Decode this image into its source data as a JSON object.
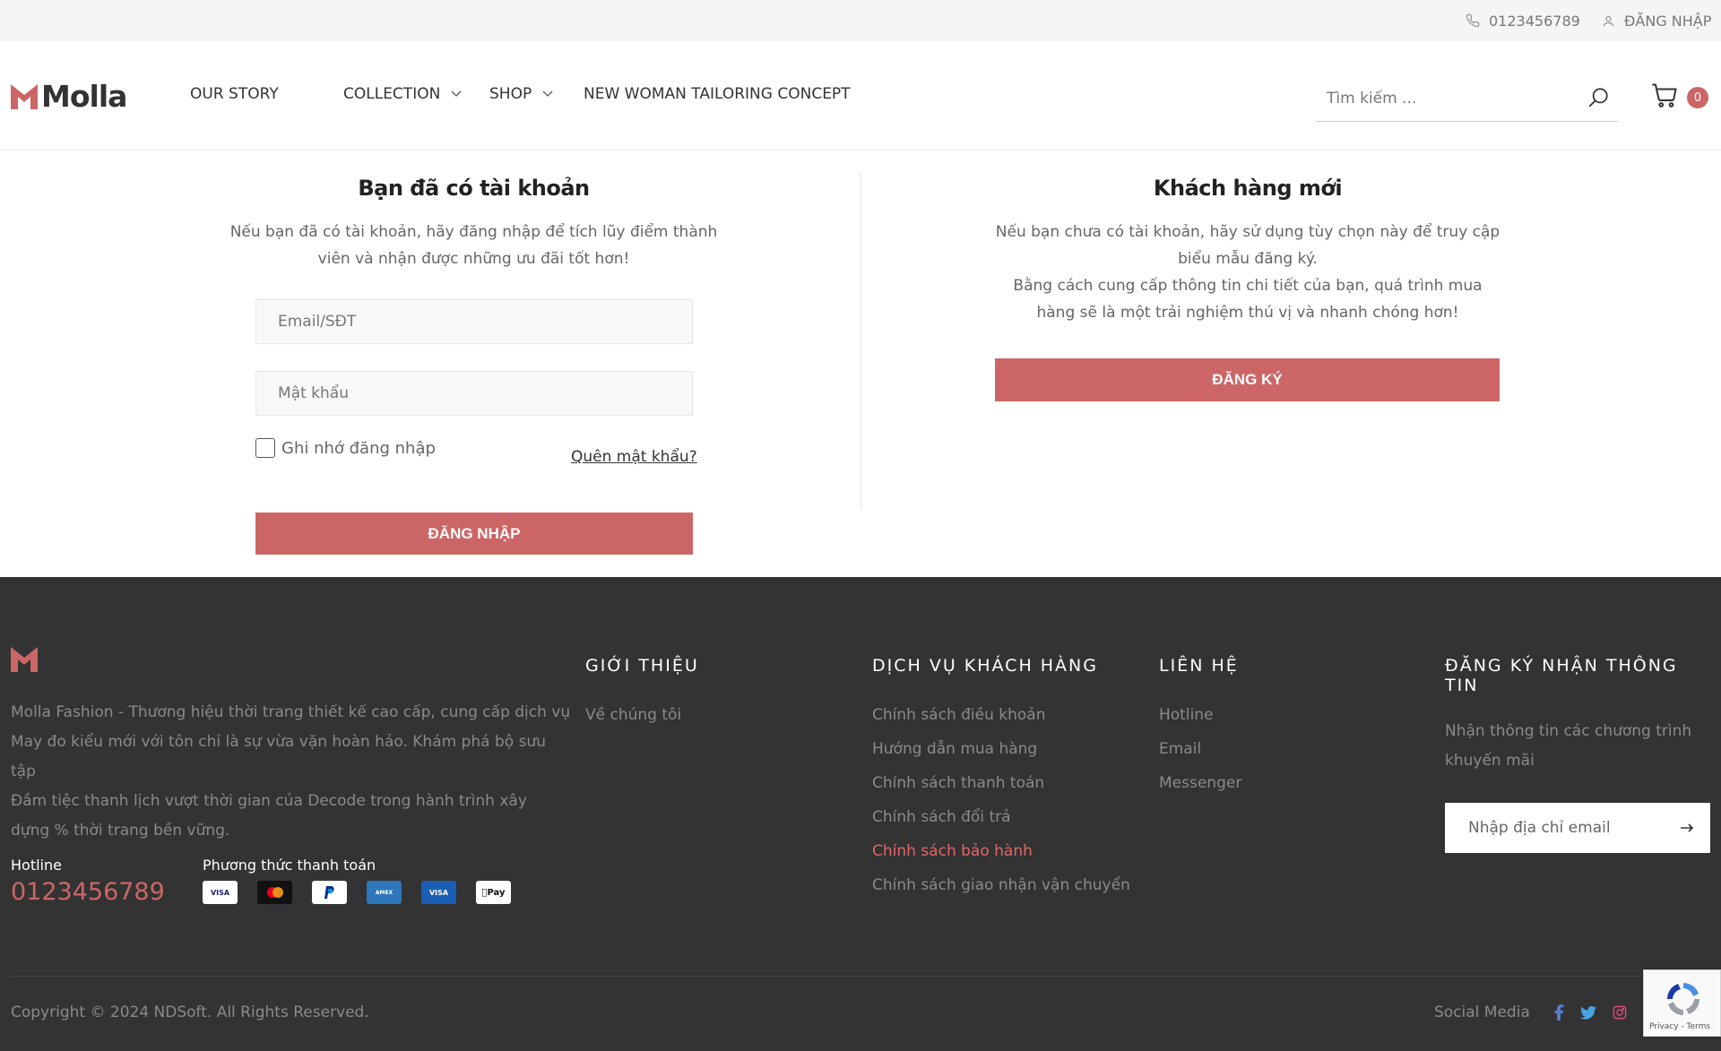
{
  "topbar": {
    "phone": "0123456789",
    "login": "ĐĂNG NHẬP"
  },
  "header": {
    "logo_text": "Molla",
    "nav": [
      {
        "label": "OUR STORY",
        "has_dropdown": false
      },
      {
        "label": "COLLECTION",
        "has_dropdown": true
      },
      {
        "label": "SHOP",
        "has_dropdown": true
      },
      {
        "label": "NEW WOMAN TAILORING CONCEPT",
        "has_dropdown": false
      }
    ],
    "search_placeholder": "Tìm kiếm ...",
    "cart_count": "0"
  },
  "login": {
    "title": "Bạn đã có tài khoản",
    "desc_line1": "Nếu bạn đã có tài khoản, hãy đăng nhập để tích lũy điểm thành",
    "desc_line2": "viên và nhận được những ưu đãi tốt hơn!",
    "email_placeholder": "Email/SĐT",
    "password_placeholder": "Mật khẩu",
    "remember_label": "Ghi nhớ đăng nhập",
    "forgot_label": "Quên mật khẩu?",
    "submit_label": "ĐĂNG NHẬP"
  },
  "register": {
    "title": "Khách hàng mới",
    "desc_line1": "Nếu bạn chưa có tài khoản, hãy sử dụng tùy chọn này để truy cập",
    "desc_line2": "biểu mẫu đăng ký.",
    "desc_line3": "Bằng cách cung cấp thông tin chi tiết của bạn, quá trình mua",
    "desc_line4": "hàng sẽ là một trải nghiệm thú vị và nhanh chóng hơn!",
    "button_label": "ĐĂNG KÝ"
  },
  "footer": {
    "about_line1": "Molla Fashion - Thương hiệu thời trang thiết kế cao cấp, cung cấp dịch vụ",
    "about_line2": "May đo kiểu mới với tôn chỉ là sự vừa vặn hoàn hảo. Khám phá bộ sưu tập",
    "about_line3": "Đầm tiệc thanh lịch vượt thời gian của Decode trong hành trình xây",
    "about_line4": "dựng % thời trang bền vững.",
    "hotline_label": "Hotline",
    "hotline_number": "0123456789",
    "payment_label": "Phương thức thanh toán",
    "payment_methods": [
      "VISA",
      "MasterCard",
      "PayPal",
      "American Express",
      "VISA Electron",
      "Apple Pay"
    ],
    "col_intro": {
      "heading": "GIỚI THIỆU",
      "items": [
        "Về chúng tôi"
      ]
    },
    "col_service": {
      "heading": "DỊCH VỤ KHÁCH HÀNG",
      "items": [
        "Chính sách điều khoản",
        "Hướng dẫn mua hàng",
        "Chính sách thanh toán",
        "Chính sách đổi trả",
        "Chính sách bảo hành",
        "Chính sách giao nhận vận chuyển"
      ],
      "active_index": 4
    },
    "col_contact": {
      "heading": "LIÊN HỆ",
      "items": [
        "Hotline",
        "Email",
        "Messenger"
      ]
    },
    "col_subscribe": {
      "heading_line1": "ĐĂNG KÝ NHẬN THÔNG",
      "heading_line2": "TIN",
      "desc_line1": "Nhận thông tin các chương trình",
      "desc_line2": "khuyến mãi",
      "email_placeholder": "Nhập địa chỉ email"
    },
    "copyright": "Copyright © 2024 NDSoft. All Rights Reserved.",
    "social_label": "Social Media",
    "social_icons": [
      "facebook-icon",
      "twitter-icon",
      "instagram-icon",
      "youtube-icon",
      "pinterest-icon"
    ]
  },
  "recaptcha": {
    "text": "Privacy - Terms"
  },
  "colors": {
    "accent": "#cc6666",
    "footer_bg": "#333333",
    "topbar_bg": "#f5f5f5"
  }
}
